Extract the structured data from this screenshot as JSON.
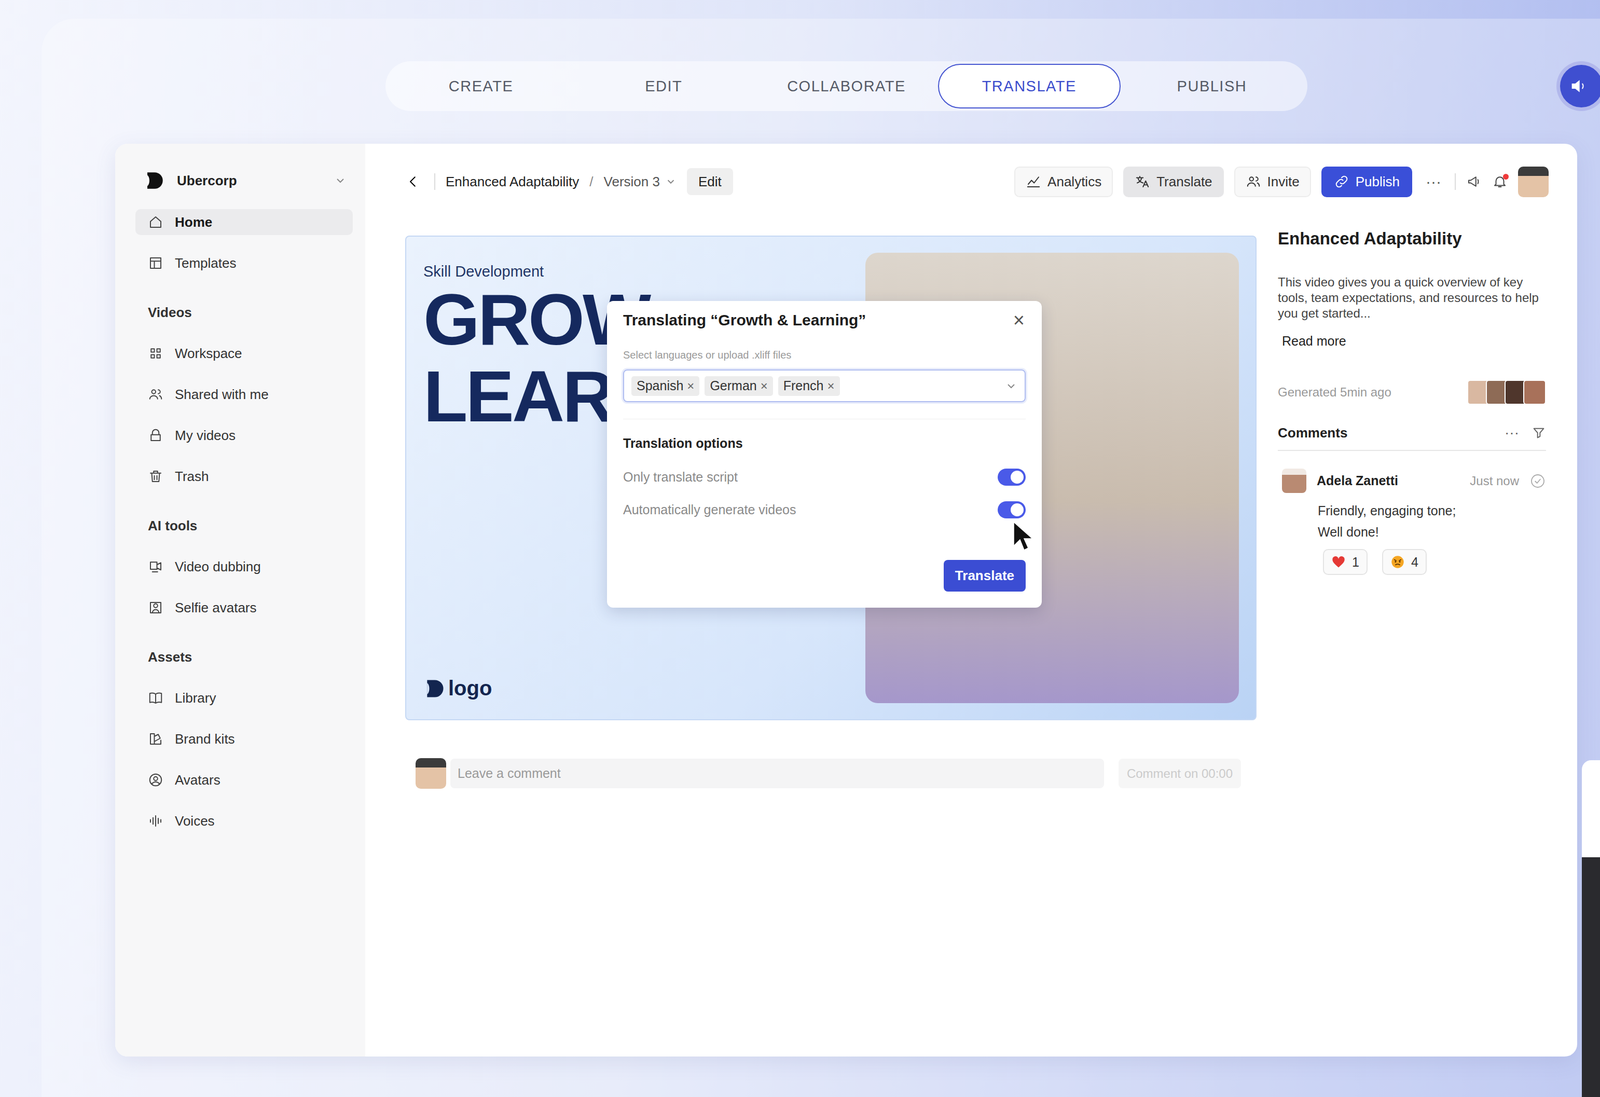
{
  "stage_tabs": [
    {
      "label": "CREATE",
      "selected": false
    },
    {
      "label": "EDIT",
      "selected": false
    },
    {
      "label": "COLLABORATE",
      "selected": false
    },
    {
      "label": "TRANSLATE",
      "selected": true
    },
    {
      "label": "PUBLISH",
      "selected": false
    }
  ],
  "sidebar": {
    "workspace": "Ubercorp",
    "top_items": [
      {
        "label": "Home",
        "selected": true
      },
      {
        "label": "Templates",
        "selected": false
      }
    ],
    "groups": [
      {
        "heading": "Videos",
        "items": [
          {
            "label": "Workspace",
            "selected": false
          },
          {
            "label": "Shared with me",
            "selected": false
          },
          {
            "label": "My videos",
            "selected": false
          },
          {
            "label": "Trash",
            "selected": false
          }
        ]
      },
      {
        "heading": "AI tools",
        "items": [
          {
            "label": "Video dubbing",
            "selected": false
          },
          {
            "label": "Selfie avatars",
            "selected": false
          }
        ]
      },
      {
        "heading": "Assets",
        "items": [
          {
            "label": "Library",
            "selected": false
          },
          {
            "label": "Brand kits",
            "selected": false
          },
          {
            "label": "Avatars",
            "selected": false
          },
          {
            "label": "Voices",
            "selected": false
          }
        ]
      }
    ]
  },
  "toolbar": {
    "breadcrumb": "Enhanced Adaptability",
    "separator": "/",
    "version": "Version 3",
    "edit": "Edit",
    "actions": [
      {
        "label": "Analytics",
        "selected": false
      },
      {
        "label": "Translate",
        "selected": true
      },
      {
        "label": "Invite",
        "selected": false
      }
    ],
    "publish": "Publish",
    "more": "···",
    "notifications_unread": true
  },
  "video": {
    "eyebrow": "Skill Development",
    "headline": [
      "GROW",
      "LEAR"
    ],
    "logo": "logo"
  },
  "dialog": {
    "title": "Translating “Growth & Learning”",
    "close": "×",
    "hint": "Select languages or upload .xliff files",
    "languages": [
      "Spanish",
      "German",
      "French"
    ],
    "chip_remove": "×",
    "options_title": "Translation options",
    "options": [
      {
        "label": "Only translate script",
        "on": true
      },
      {
        "label": "Automatically generate videos",
        "on": true
      }
    ],
    "submit": "Translate"
  },
  "details": {
    "title": "Enhanced Adaptability",
    "description": "This video gives you a quick overview of key tools, team expectations, and resources to help you get started...",
    "read_more": "Read more",
    "generated": "Generated 5min ago",
    "collaborators": [
      {
        "color": "#d9b8a1"
      },
      {
        "color": "#8e6b56"
      },
      {
        "color": "#4f362c"
      },
      {
        "color": "#a8715a"
      }
    ]
  },
  "comments": {
    "title": "Comments",
    "more": "···",
    "items": [
      {
        "author": "Adela Zanetti",
        "time": "Just now",
        "resolved": false,
        "lines": [
          "Friendly, engaging tone;",
          "Well done!"
        ],
        "reactions": [
          {
            "kind": "heart",
            "count": "1"
          },
          {
            "kind": "angry",
            "count": "4"
          }
        ]
      }
    ]
  },
  "comment_bar": {
    "placeholder": "Leave a comment",
    "button": "Comment on 00:00",
    "button_disabled": true
  }
}
